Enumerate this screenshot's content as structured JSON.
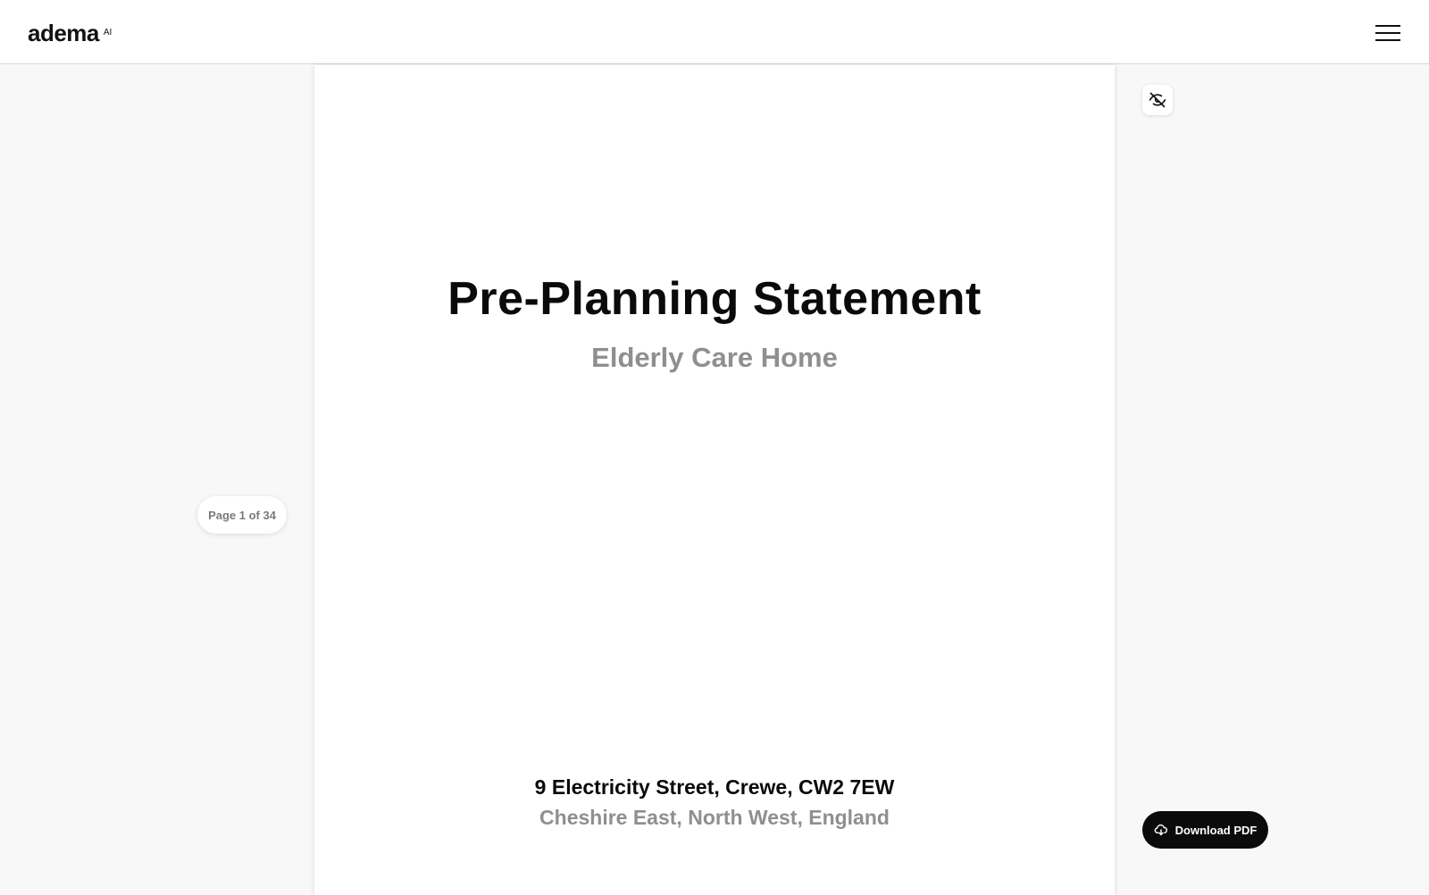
{
  "header": {
    "logo_text": "adema",
    "logo_badge": "AI",
    "menu_icon": "hamburger-menu-icon"
  },
  "document": {
    "title": "Pre-Planning Statement",
    "subtitle": "Elderly Care Home",
    "address": "9 Electricity Street, Crewe, CW2 7EW",
    "region": "Cheshire East, North West, England"
  },
  "pagination": {
    "label": "Page 1 of 34",
    "current": 1,
    "total": 34
  },
  "toolbar": {
    "visibility_icon": "eye-off-icon",
    "download_label": "Download PDF",
    "download_icon": "cloud-download-icon"
  },
  "colors": {
    "background": "#f8f8f8",
    "page": "#ffffff",
    "text_primary": "#0a0a0a",
    "text_muted": "#8f8f8f",
    "button_dark": "#0b0b0b"
  }
}
